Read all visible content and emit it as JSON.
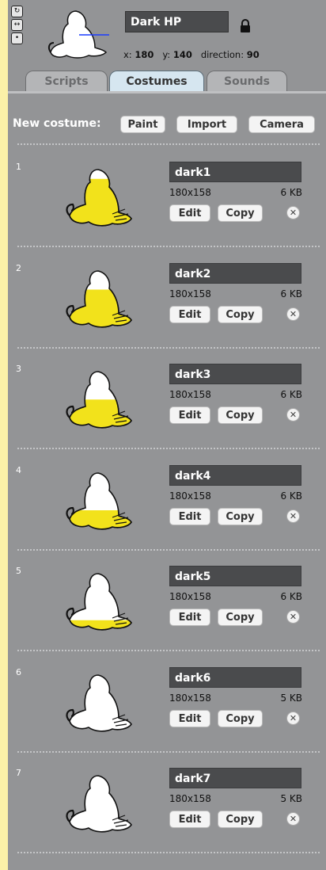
{
  "sprite": {
    "name": "Dark HP",
    "x_label": "x:",
    "x_value": "180",
    "y_label": "y:",
    "y_value": "140",
    "direction_label": "direction:",
    "direction_value": "90"
  },
  "rotation_style": {
    "rotate": "↻",
    "flip": "↔",
    "none": "•"
  },
  "tabs": [
    "Scripts",
    "Costumes",
    "Sounds"
  ],
  "new_costume": {
    "label": "New costume:",
    "paint": "Paint",
    "import": "Import",
    "camera": "Camera"
  },
  "costumes": [
    {
      "number": "1",
      "name": "dark1",
      "dimensions": "180x158",
      "size": "6 KB",
      "fill_level": 0.86,
      "fill_color": "#f2e21b"
    },
    {
      "number": "2",
      "name": "dark2",
      "dimensions": "180x158",
      "size": "6 KB",
      "fill_level": 0.72,
      "fill_color": "#f2e21b"
    },
    {
      "number": "3",
      "name": "dark3",
      "dimensions": "180x158",
      "size": "6 KB",
      "fill_level": 0.58,
      "fill_color": "#f2e21b"
    },
    {
      "number": "4",
      "name": "dark4",
      "dimensions": "180x158",
      "size": "6 KB",
      "fill_level": 0.44,
      "fill_color": "#f2e21b"
    },
    {
      "number": "5",
      "name": "dark5",
      "dimensions": "180x158",
      "size": "6 KB",
      "fill_level": 0.3,
      "fill_color": "#f2e21b"
    },
    {
      "number": "6",
      "name": "dark6",
      "dimensions": "180x158",
      "size": "5 KB",
      "fill_level": 0.12,
      "fill_color": "#d92020"
    },
    {
      "number": "7",
      "name": "dark7",
      "dimensions": "180x158",
      "size": "5 KB",
      "fill_level": 0.0,
      "fill_color": "#ffffff"
    }
  ],
  "costume_actions": {
    "edit": "Edit",
    "copy": "Copy",
    "delete": "✕"
  }
}
